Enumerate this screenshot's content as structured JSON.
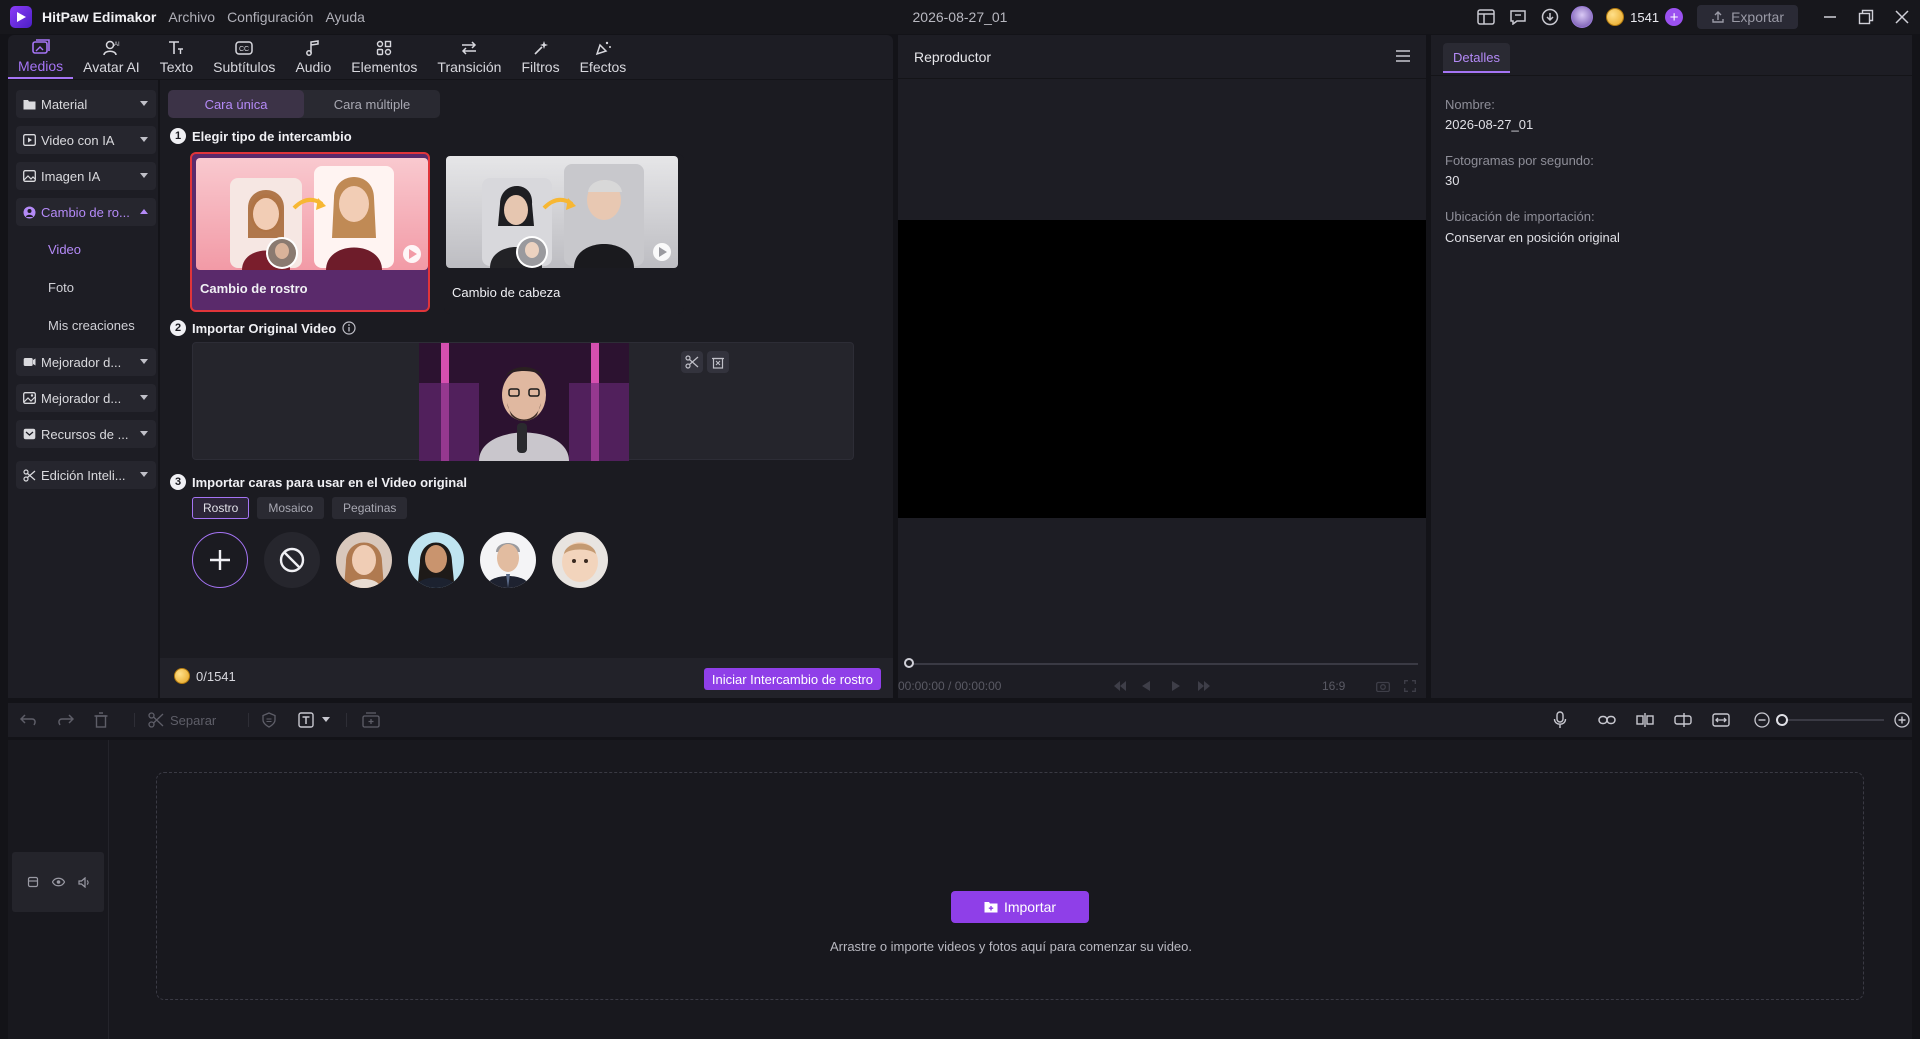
{
  "app": {
    "name": "HitPaw Edimakor",
    "menu": [
      "Archivo",
      "Configuración",
      "Ayuda"
    ],
    "doc_title": "2026-08-27_01",
    "credits": "1541",
    "export_label": "Exportar"
  },
  "toolbar": {
    "tabs": [
      {
        "label": "Medios",
        "icon": "media-icon",
        "active": true
      },
      {
        "label": "Avatar AI",
        "icon": "avatar-icon"
      },
      {
        "label": "Texto",
        "icon": "text-icon"
      },
      {
        "label": "Subtítulos",
        "icon": "subtitles-icon"
      },
      {
        "label": "Audio",
        "icon": "audio-icon"
      },
      {
        "label": "Elementos",
        "icon": "elements-icon"
      },
      {
        "label": "Transición",
        "icon": "transition-icon"
      },
      {
        "label": "Filtros",
        "icon": "filters-icon"
      },
      {
        "label": "Efectos",
        "icon": "effects-icon"
      }
    ]
  },
  "sidebar": {
    "items": [
      {
        "label": "Material",
        "icon": "folder-icon"
      },
      {
        "label": "Video con IA",
        "icon": "video-ai-icon"
      },
      {
        "label": "Imagen IA",
        "icon": "image-ai-icon"
      },
      {
        "label": "Cambio de ro...",
        "icon": "face-swap-icon",
        "open": true
      },
      {
        "label": "Mejorador d...",
        "icon": "video-enhance-icon"
      },
      {
        "label": "Mejorador d...",
        "icon": "image-enhance-icon"
      },
      {
        "label": "Recursos de ...",
        "icon": "resources-icon"
      },
      {
        "label": "Edición Inteli...",
        "icon": "smart-edit-icon"
      }
    ],
    "subitems": [
      {
        "label": "Video",
        "active": true
      },
      {
        "label": "Foto"
      },
      {
        "label": "Mis creaciones"
      }
    ]
  },
  "main": {
    "segments": [
      "Cara única",
      "Cara múltiple"
    ],
    "step1": {
      "num": "1",
      "title": "Elegir tipo de intercambio"
    },
    "cards": [
      {
        "label": "Cambio de rostro",
        "selected": true
      },
      {
        "label": "Cambio de cabeza"
      }
    ],
    "step2": {
      "num": "2",
      "title": "Importar Original Video"
    },
    "step3": {
      "num": "3",
      "title": "Importar caras para usar en el Video original"
    },
    "face_tabs": [
      "Rostro",
      "Mosaico",
      "Pegatinas"
    ],
    "credit_usage": "0/1541",
    "start_label": "Iniciar Intercambio de rostro"
  },
  "player": {
    "title": "Reproductor",
    "time": "00:00:00 / 00:00:00",
    "ratio": "16:9"
  },
  "details": {
    "tab": "Detalles",
    "fields": [
      {
        "label": "Nombre:",
        "value": "2026-08-27_01"
      },
      {
        "label": "Fotogramas por segundo:",
        "value": "30"
      },
      {
        "label": "Ubicación de importación:",
        "value": "Conservar en posición original"
      }
    ]
  },
  "timeline": {
    "split_label": "Separar",
    "import_label": "Importar",
    "drop_hint": "Arrastre o importe videos y fotos aquí para comenzar su video."
  },
  "colors": {
    "accent": "#8f3fe8",
    "accent_text": "#b48af7",
    "bg": "#131318",
    "panel": "#1d1d24"
  }
}
